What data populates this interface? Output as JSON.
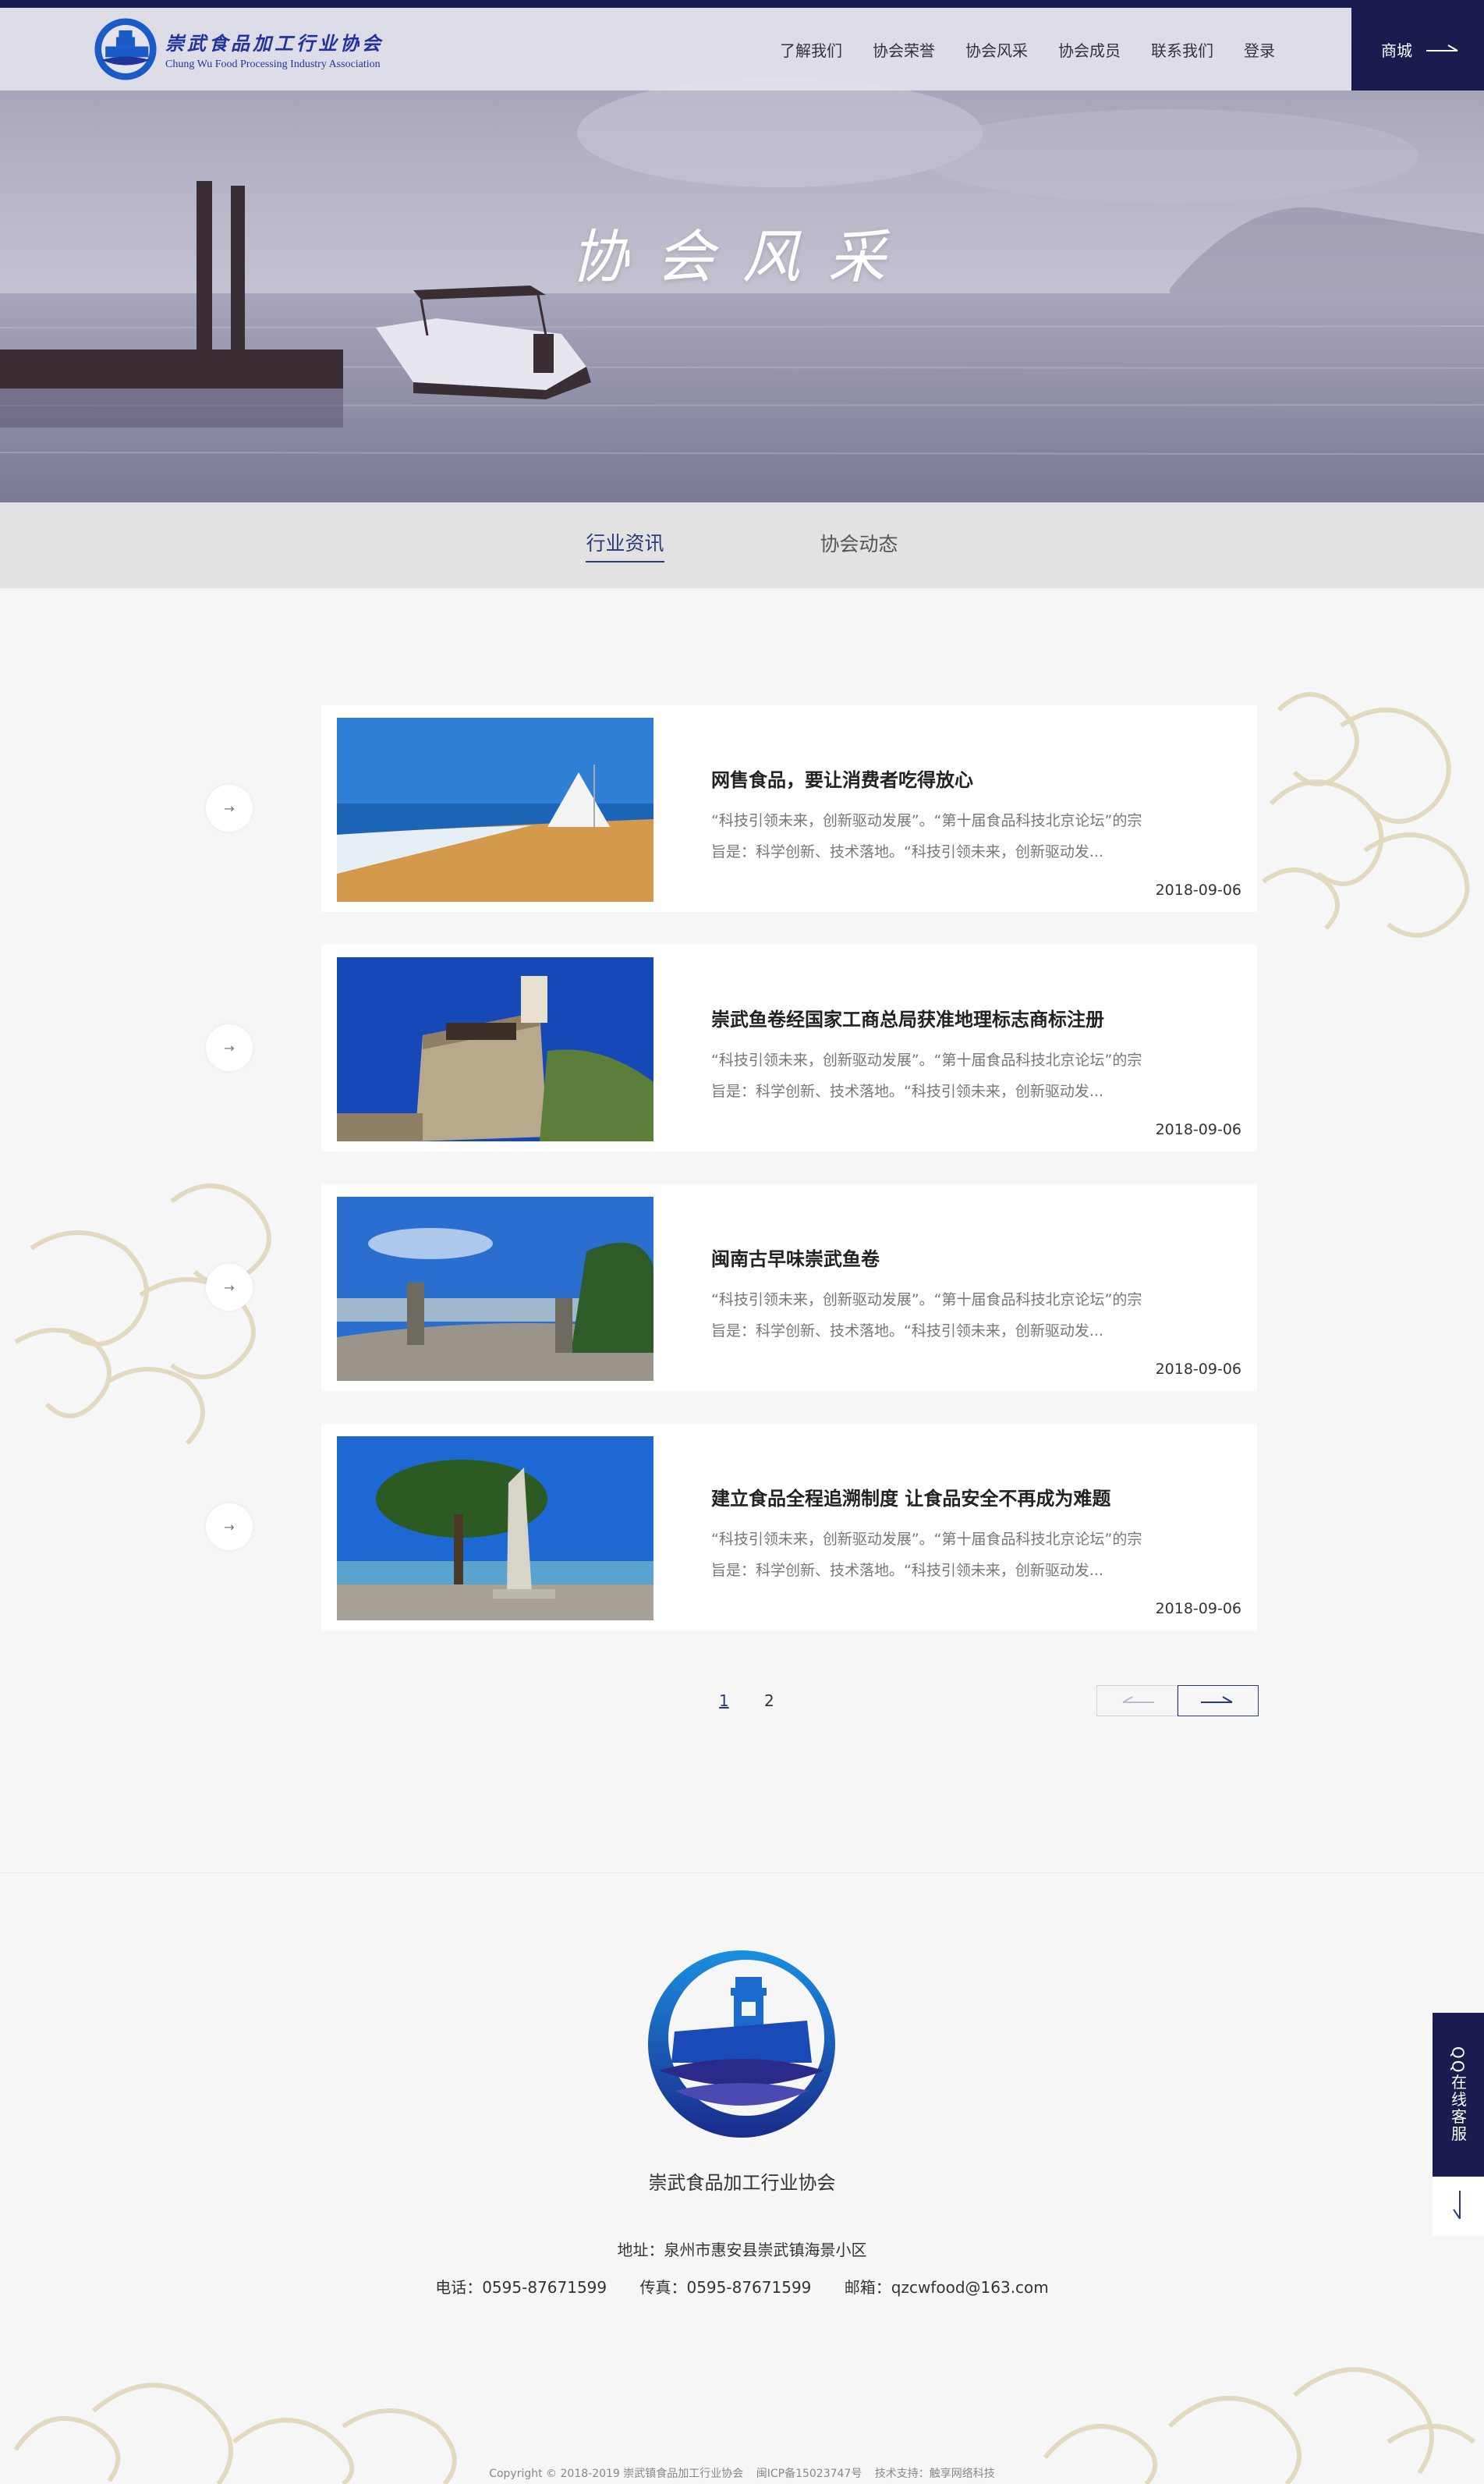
{
  "header": {
    "logo_cn": "崇武食品加工行业协会",
    "logo_en": "Chung Wu Food Processing Industry Association",
    "nav": [
      "了解我们",
      "协会荣誉",
      "协会风采",
      "协会成员",
      "联系我们",
      "登录"
    ],
    "shop_label": "商城"
  },
  "hero": {
    "title": "协会风采"
  },
  "tabs": [
    {
      "label": "行业资讯",
      "active": true
    },
    {
      "label": "协会动态",
      "active": false
    }
  ],
  "news": [
    {
      "title": "网售食品，要让消费者吃得放心",
      "summary_line1": "“科技引领未来，创新驱动发展”。“第十届食品科技北京论坛”的宗",
      "summary_line2": "旨是：科学创新、技术落地。“科技引领未来，创新驱动发...",
      "date": "2018-09-06"
    },
    {
      "title": "崇武鱼卷经国家工商总局获准地理标志商标注册",
      "summary_line1": "“科技引领未来，创新驱动发展”。“第十届食品科技北京论坛”的宗",
      "summary_line2": "旨是：科学创新、技术落地。“科技引领未来，创新驱动发...",
      "date": "2018-09-06"
    },
    {
      "title": "闽南古早味崇武鱼卷",
      "summary_line1": "“科技引领未来，创新驱动发展”。“第十届食品科技北京论坛”的宗",
      "summary_line2": "旨是：科学创新、技术落地。“科技引领未来，创新驱动发...",
      "date": "2018-09-06"
    },
    {
      "title": "建立食品全程追溯制度 让食品安全不再成为难题",
      "summary_line1": "“科技引领未来，创新驱动发展”。“第十届食品科技北京论坛”的宗",
      "summary_line2": "旨是：科学创新、技术落地。“科技引领未来，创新驱动发...",
      "date": "2018-09-06"
    }
  ],
  "news_arrow": "→",
  "pagination": {
    "pages": [
      "1",
      "2"
    ],
    "current": "1"
  },
  "footer": {
    "name": "崇武食品加工行业协会",
    "address": "地址：泉州市惠安县崇武镇海景小区",
    "phone": "电话：0595-87671599",
    "fax": "传真：0595-87671599",
    "email": "邮箱：qzcwfood@163.com",
    "copyright": "Copyright © 2018-2019  崇武镇食品加工行业协会",
    "icp": "闽ICP备15023747号",
    "tech": "技术支持：触享网络科技"
  },
  "float": {
    "qq_label": "QQ在线客服"
  },
  "colors": {
    "navy": "#1a1c50",
    "accent": "#2a3a78"
  }
}
